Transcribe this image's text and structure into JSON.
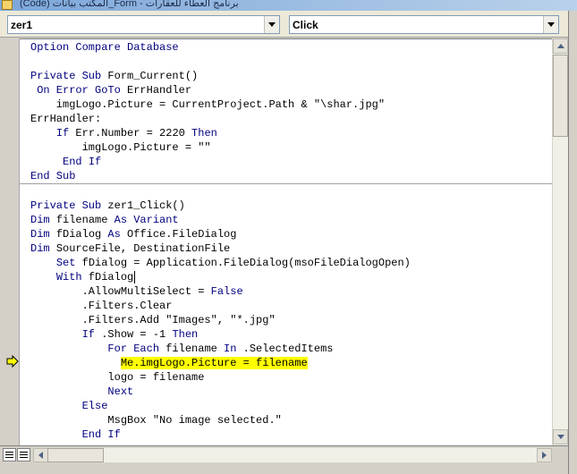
{
  "window": {
    "title": "برنامج العطاء للعقارات - Form_المكتب بيانات (Code)"
  },
  "object_combo": {
    "value": "zer1"
  },
  "procedure_combo": {
    "value": "Click"
  },
  "code": {
    "block1": [
      [
        {
          "t": "Option Compare Database",
          "k": true
        }
      ],
      [],
      [
        {
          "t": "Private Sub ",
          "k": true
        },
        {
          "t": "Form_Current()"
        }
      ],
      [
        {
          "t": " On Error GoTo ",
          "k": true
        },
        {
          "t": "ErrHandler"
        }
      ],
      [
        {
          "t": "    imgLogo.Picture = CurrentProject.Path & \"\\shar.jpg\""
        }
      ],
      [
        {
          "t": "ErrHandler:"
        }
      ],
      [
        {
          "t": "    "
        },
        {
          "t": "If ",
          "k": true
        },
        {
          "t": "Err.Number = 2220 "
        },
        {
          "t": "Then",
          "k": true
        }
      ],
      [
        {
          "t": "        imgLogo.Picture = \"\""
        }
      ],
      [
        {
          "t": "     "
        },
        {
          "t": "End If",
          "k": true
        }
      ],
      [
        {
          "t": "End Sub",
          "k": true
        }
      ]
    ],
    "block2": [
      [],
      [
        {
          "t": "Private Sub ",
          "k": true
        },
        {
          "t": "zer1_Click()"
        }
      ],
      [
        {
          "t": "Dim ",
          "k": true
        },
        {
          "t": "filename "
        },
        {
          "t": "As Variant",
          "k": true
        }
      ],
      [
        {
          "t": "Dim ",
          "k": true
        },
        {
          "t": "fDialog "
        },
        {
          "t": "As ",
          "k": true
        },
        {
          "t": "Office.FileDialog"
        }
      ],
      [
        {
          "t": "Dim ",
          "k": true
        },
        {
          "t": "SourceFile, DestinationFile"
        }
      ],
      [
        {
          "t": "    "
        },
        {
          "t": "Set ",
          "k": true
        },
        {
          "t": "fDialog = Application.FileDialog(msoFileDialogOpen)"
        }
      ],
      [
        {
          "t": "    "
        },
        {
          "t": "With ",
          "k": true
        },
        {
          "t": "fDialog"
        },
        {
          "caret": true
        }
      ],
      [
        {
          "t": "        .AllowMultiSelect = "
        },
        {
          "t": "False",
          "k": true
        }
      ],
      [
        {
          "t": "        .Filters.Clear"
        }
      ],
      [
        {
          "t": "        .Filters.Add \"Images\", \"*.jpg\""
        }
      ],
      [
        {
          "t": "        "
        },
        {
          "t": "If ",
          "k": true
        },
        {
          "t": ".Show = -1 "
        },
        {
          "t": "Then",
          "k": true
        }
      ],
      [
        {
          "t": "            "
        },
        {
          "t": "For Each ",
          "k": true
        },
        {
          "t": "filename "
        },
        {
          "t": "In ",
          "k": true
        },
        {
          "t": ".SelectedItems"
        }
      ],
      [
        {
          "t": "              "
        },
        {
          "t": "Me.imgLogo.Picture = filename",
          "hl": true
        }
      ],
      [
        {
          "t": "            logo = filename"
        }
      ],
      [
        {
          "t": "            "
        },
        {
          "t": "Next",
          "k": true
        }
      ],
      [
        {
          "t": "        "
        },
        {
          "t": "Else",
          "k": true
        }
      ],
      [
        {
          "t": "            MsgBox \"No image selected.\""
        }
      ],
      [
        {
          "t": "        "
        },
        {
          "t": "End If",
          "k": true
        }
      ]
    ]
  },
  "colors": {
    "keyword": "#00007f",
    "highlight": "#ffff00",
    "exec_arrow": "#ffff00"
  }
}
